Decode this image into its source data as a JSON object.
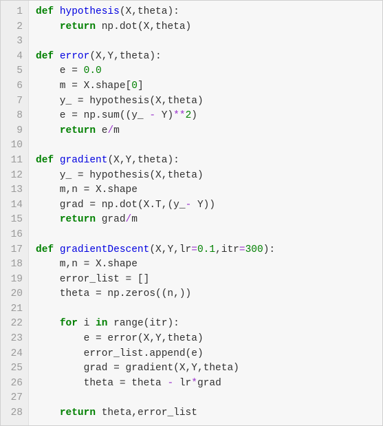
{
  "lines": [
    {
      "n": 1,
      "tokens": [
        [
          "kw",
          "def "
        ],
        [
          "fn",
          "hypothesis"
        ],
        [
          "",
          "(X,theta):"
        ]
      ]
    },
    {
      "n": 2,
      "tokens": [
        [
          "",
          "    "
        ],
        [
          "kw",
          "return"
        ],
        [
          "",
          " np.dot(X,theta)"
        ]
      ]
    },
    {
      "n": 3,
      "tokens": [
        [
          "",
          ""
        ]
      ]
    },
    {
      "n": 4,
      "tokens": [
        [
          "kw",
          "def "
        ],
        [
          "fn",
          "error"
        ],
        [
          "",
          "(X,Y,theta):"
        ]
      ]
    },
    {
      "n": 5,
      "tokens": [
        [
          "",
          "    e "
        ],
        [
          "eq",
          "="
        ],
        [
          "",
          " "
        ],
        [
          "num",
          "0.0"
        ]
      ]
    },
    {
      "n": 6,
      "tokens": [
        [
          "",
          "    m "
        ],
        [
          "eq",
          "="
        ],
        [
          "",
          " X.shape["
        ],
        [
          "num",
          "0"
        ],
        [
          "",
          "]"
        ]
      ]
    },
    {
      "n": 7,
      "tokens": [
        [
          "",
          "    y_ "
        ],
        [
          "eq",
          "="
        ],
        [
          "",
          " hypothesis(X,theta)"
        ]
      ]
    },
    {
      "n": 8,
      "tokens": [
        [
          "",
          "    e "
        ],
        [
          "eq",
          "="
        ],
        [
          "",
          " np.sum((y_ "
        ],
        [
          "op",
          "-"
        ],
        [
          "",
          " Y)"
        ],
        [
          "op",
          "**"
        ],
        [
          "num",
          "2"
        ],
        [
          "",
          ")"
        ]
      ]
    },
    {
      "n": 9,
      "tokens": [
        [
          "",
          "    "
        ],
        [
          "kw",
          "return"
        ],
        [
          "",
          " e"
        ],
        [
          "op",
          "/"
        ],
        [
          "",
          "m"
        ]
      ]
    },
    {
      "n": 10,
      "tokens": [
        [
          "",
          ""
        ]
      ]
    },
    {
      "n": 11,
      "tokens": [
        [
          "kw",
          "def "
        ],
        [
          "fn",
          "gradient"
        ],
        [
          "",
          "(X,Y,theta):"
        ]
      ]
    },
    {
      "n": 12,
      "tokens": [
        [
          "",
          "    y_ "
        ],
        [
          "eq",
          "="
        ],
        [
          "",
          " hypothesis(X,theta)"
        ]
      ]
    },
    {
      "n": 13,
      "tokens": [
        [
          "",
          "    m,n "
        ],
        [
          "eq",
          "="
        ],
        [
          "",
          " X.shape"
        ]
      ]
    },
    {
      "n": 14,
      "tokens": [
        [
          "",
          "    grad "
        ],
        [
          "eq",
          "="
        ],
        [
          "",
          " np.dot(X.T,(y_"
        ],
        [
          "op",
          "-"
        ],
        [
          "",
          " Y))"
        ]
      ]
    },
    {
      "n": 15,
      "tokens": [
        [
          "",
          "    "
        ],
        [
          "kw",
          "return"
        ],
        [
          "",
          " grad"
        ],
        [
          "op",
          "/"
        ],
        [
          "",
          "m"
        ]
      ]
    },
    {
      "n": 16,
      "tokens": [
        [
          "",
          ""
        ]
      ]
    },
    {
      "n": 17,
      "tokens": [
        [
          "kw",
          "def "
        ],
        [
          "fn",
          "gradientDescent"
        ],
        [
          "",
          "(X,Y,lr"
        ],
        [
          "op",
          "="
        ],
        [
          "num",
          "0.1"
        ],
        [
          "",
          ",itr"
        ],
        [
          "op",
          "="
        ],
        [
          "num",
          "300"
        ],
        [
          "",
          "):"
        ]
      ]
    },
    {
      "n": 18,
      "tokens": [
        [
          "",
          "    m,n "
        ],
        [
          "eq",
          "="
        ],
        [
          "",
          " X.shape"
        ]
      ]
    },
    {
      "n": 19,
      "tokens": [
        [
          "",
          "    error_list "
        ],
        [
          "eq",
          "="
        ],
        [
          "",
          " []"
        ]
      ]
    },
    {
      "n": 20,
      "tokens": [
        [
          "",
          "    theta "
        ],
        [
          "eq",
          "="
        ],
        [
          "",
          " np.zeros((n,))"
        ]
      ]
    },
    {
      "n": 21,
      "tokens": [
        [
          "",
          ""
        ]
      ]
    },
    {
      "n": 22,
      "tokens": [
        [
          "",
          "    "
        ],
        [
          "kw",
          "for"
        ],
        [
          "",
          " i "
        ],
        [
          "kw",
          "in"
        ],
        [
          "",
          " range(itr):"
        ]
      ]
    },
    {
      "n": 23,
      "tokens": [
        [
          "",
          "        e "
        ],
        [
          "eq",
          "="
        ],
        [
          "",
          " error(X,Y,theta)"
        ]
      ]
    },
    {
      "n": 24,
      "tokens": [
        [
          "",
          "        error_list.append(e)"
        ]
      ]
    },
    {
      "n": 25,
      "tokens": [
        [
          "",
          "        grad "
        ],
        [
          "eq",
          "="
        ],
        [
          "",
          " gradient(X,Y,theta)"
        ]
      ]
    },
    {
      "n": 26,
      "tokens": [
        [
          "",
          "        theta "
        ],
        [
          "eq",
          "="
        ],
        [
          "",
          " theta "
        ],
        [
          "op",
          "-"
        ],
        [
          "",
          " lr"
        ],
        [
          "op",
          "*"
        ],
        [
          "",
          "grad"
        ]
      ]
    },
    {
      "n": 27,
      "tokens": [
        [
          "",
          ""
        ]
      ]
    },
    {
      "n": 28,
      "tokens": [
        [
          "",
          "    "
        ],
        [
          "kw",
          "return"
        ],
        [
          "",
          " theta,error_list"
        ]
      ]
    }
  ]
}
